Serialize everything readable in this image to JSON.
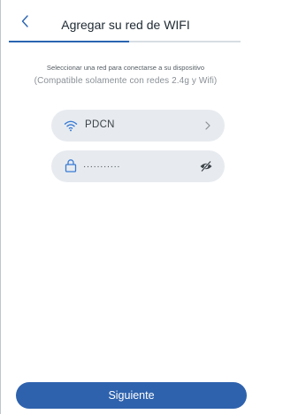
{
  "header": {
    "back_icon": "chevron-left-icon",
    "title": "Agregar su red de WIFI",
    "progress": 0.52,
    "accent_color": "#2a64b1"
  },
  "main": {
    "instructions": "Seleccionar una red para conectarse a su dispositivo",
    "compatibility_note": "(Compatible solamente con redes 2.4g y Wifi)",
    "network_field": {
      "icon": "wifi-icon",
      "value": "PDCN",
      "trailing_icon": "chevron-right-icon"
    },
    "password_field": {
      "icon": "lock-icon",
      "value": "···········",
      "trailing_icon": "eye-slash-icon"
    }
  },
  "footer": {
    "next_label": "Siguiente",
    "button_color": "#2e62ad"
  }
}
